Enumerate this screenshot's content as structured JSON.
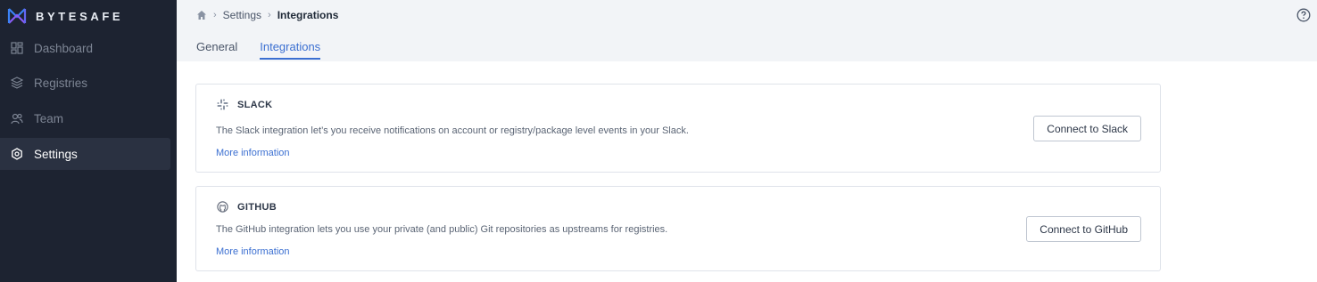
{
  "brand": {
    "name": "BYTESAFE"
  },
  "sidebar": {
    "items": [
      {
        "label": "Dashboard",
        "icon": "dashboard-icon",
        "active": false
      },
      {
        "label": "Registries",
        "icon": "layers-icon",
        "active": false
      },
      {
        "label": "Team",
        "icon": "team-icon",
        "active": false
      },
      {
        "label": "Settings",
        "icon": "gear-icon",
        "active": true
      }
    ]
  },
  "breadcrumb": {
    "home_icon": "home-icon",
    "items": [
      "Settings",
      "Integrations"
    ]
  },
  "tabs": [
    {
      "label": "General",
      "active": false
    },
    {
      "label": "Integrations",
      "active": true
    }
  ],
  "integrations": [
    {
      "icon": "slack-icon",
      "title": "SLACK",
      "description": "The Slack integration let’s you receive notifications on account or registry/package level events in your Slack.",
      "link": "More information",
      "button": "Connect to Slack"
    },
    {
      "icon": "github-icon",
      "title": "GITHUB",
      "description": "The GitHub integration lets you use your private (and public) Git repositories as upstreams for registries.",
      "link": "More information",
      "button": "Connect to GitHub"
    }
  ],
  "colors": {
    "sidebar_bg": "#1d2331",
    "accent": "#3b6fd1",
    "topbar_bg": "#f2f4f7"
  }
}
